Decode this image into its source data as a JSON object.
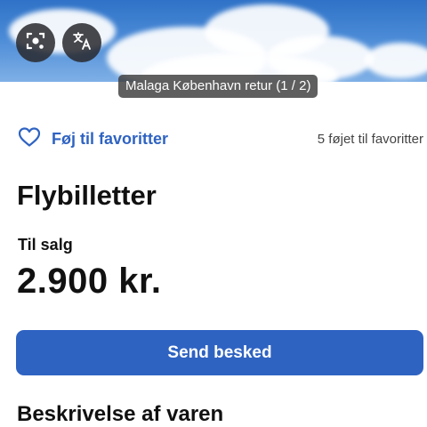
{
  "hero": {
    "caption": "Malaga København retur  (1 / 2)",
    "buttons": [
      {
        "icon": "lens-icon"
      },
      {
        "icon": "translate-icon"
      }
    ]
  },
  "favorites": {
    "label": "Føj til favoritter",
    "count_text": "5 føjet til favoritter",
    "icon": "heart-outline-icon"
  },
  "listing": {
    "title": "Flybilletter",
    "status": "Til salg",
    "price": "2.900 kr."
  },
  "actions": {
    "send_label": "Send besked"
  },
  "section": {
    "description_title": "Beskrivelse af varen"
  },
  "colors": {
    "accent": "#2f63c2",
    "text": "#111111"
  }
}
